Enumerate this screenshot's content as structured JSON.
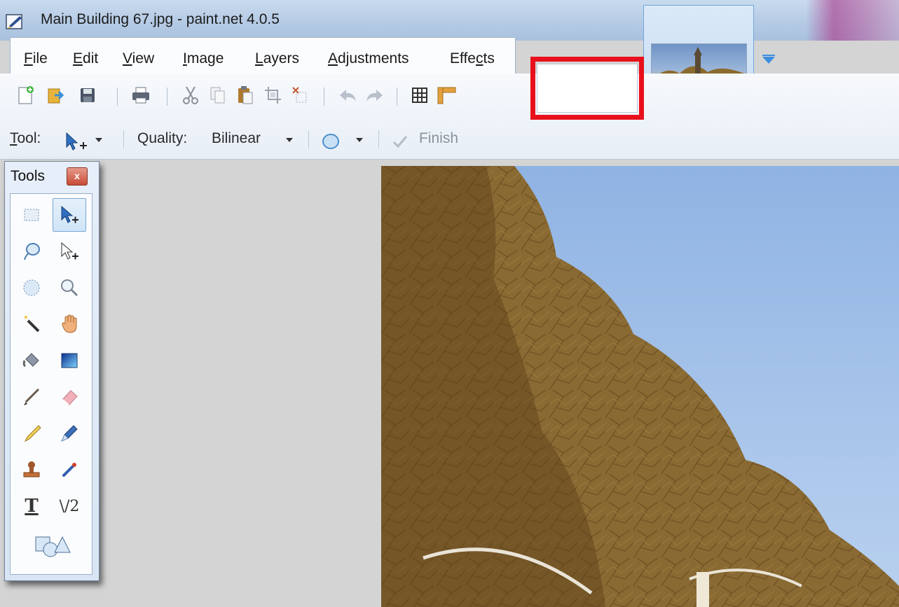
{
  "window": {
    "title": "Main Building 67.jpg - paint.net 4.0.5"
  },
  "menu": {
    "items": [
      {
        "label": "File",
        "accel": "F",
        "rest": "ile"
      },
      {
        "label": "Edit",
        "accel": "E",
        "rest": "dit"
      },
      {
        "label": "View",
        "accel": "V",
        "rest": "iew"
      },
      {
        "label": "Image",
        "accel": "I",
        "rest": "mage"
      },
      {
        "label": "Layers",
        "accel": "L",
        "rest": "ayers"
      },
      {
        "label": "Adjustments",
        "accel": "A",
        "rest": "djustments"
      },
      {
        "label": "Effects",
        "pre": "Effe",
        "accel": "c",
        "rest": "ts"
      }
    ]
  },
  "toolbar": {
    "icons": [
      "new-icon",
      "open-icon",
      "save-icon",
      "print-icon",
      "cut-icon",
      "copy-icon",
      "paste-icon",
      "crop-icon",
      "deselect-icon",
      "undo-icon",
      "redo-icon",
      "grid-icon",
      "ruler-icon"
    ]
  },
  "tool_options": {
    "tool_label_accel": "T",
    "tool_label_rest": "ool:",
    "quality_label": "Quality:",
    "quality_value": "Bilinear",
    "finish_label": "Finish"
  },
  "tools_window": {
    "title": "Tools",
    "close_symbol": "x",
    "text_tool_glyph": "T",
    "line_tool_glyph": "\\/2",
    "tools": [
      "rectangle-select",
      "move-selected-pixels",
      "lasso-select",
      "move-selection",
      "ellipse-select",
      "zoom",
      "magic-wand",
      "pan",
      "paint-bucket",
      "gradient",
      "paintbrush",
      "eraser",
      "pencil",
      "color-picker",
      "clone-stamp",
      "recolor",
      "text",
      "line-curve",
      "shapes"
    ]
  },
  "colors": {
    "highlight": "#e8101c",
    "sky": "#a7c4ea",
    "canvas_bg": "#d4d4d4"
  }
}
